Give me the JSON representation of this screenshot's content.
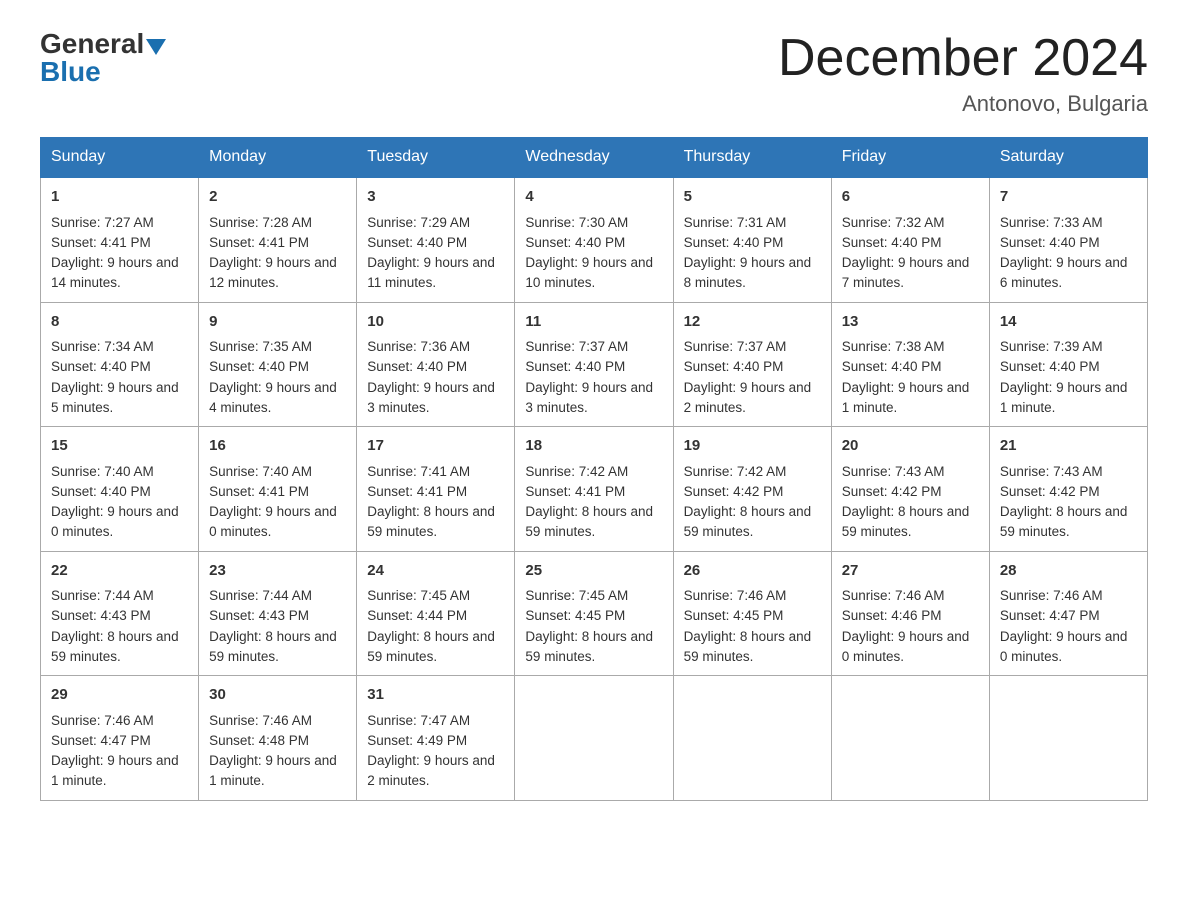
{
  "header": {
    "logo_general": "General",
    "logo_blue": "Blue",
    "month_title": "December 2024",
    "location": "Antonovo, Bulgaria"
  },
  "weekdays": [
    "Sunday",
    "Monday",
    "Tuesday",
    "Wednesday",
    "Thursday",
    "Friday",
    "Saturday"
  ],
  "weeks": [
    [
      {
        "day": "1",
        "sunrise": "7:27 AM",
        "sunset": "4:41 PM",
        "daylight": "9 hours and 14 minutes."
      },
      {
        "day": "2",
        "sunrise": "7:28 AM",
        "sunset": "4:41 PM",
        "daylight": "9 hours and 12 minutes."
      },
      {
        "day": "3",
        "sunrise": "7:29 AM",
        "sunset": "4:40 PM",
        "daylight": "9 hours and 11 minutes."
      },
      {
        "day": "4",
        "sunrise": "7:30 AM",
        "sunset": "4:40 PM",
        "daylight": "9 hours and 10 minutes."
      },
      {
        "day": "5",
        "sunrise": "7:31 AM",
        "sunset": "4:40 PM",
        "daylight": "9 hours and 8 minutes."
      },
      {
        "day": "6",
        "sunrise": "7:32 AM",
        "sunset": "4:40 PM",
        "daylight": "9 hours and 7 minutes."
      },
      {
        "day": "7",
        "sunrise": "7:33 AM",
        "sunset": "4:40 PM",
        "daylight": "9 hours and 6 minutes."
      }
    ],
    [
      {
        "day": "8",
        "sunrise": "7:34 AM",
        "sunset": "4:40 PM",
        "daylight": "9 hours and 5 minutes."
      },
      {
        "day": "9",
        "sunrise": "7:35 AM",
        "sunset": "4:40 PM",
        "daylight": "9 hours and 4 minutes."
      },
      {
        "day": "10",
        "sunrise": "7:36 AM",
        "sunset": "4:40 PM",
        "daylight": "9 hours and 3 minutes."
      },
      {
        "day": "11",
        "sunrise": "7:37 AM",
        "sunset": "4:40 PM",
        "daylight": "9 hours and 3 minutes."
      },
      {
        "day": "12",
        "sunrise": "7:37 AM",
        "sunset": "4:40 PM",
        "daylight": "9 hours and 2 minutes."
      },
      {
        "day": "13",
        "sunrise": "7:38 AM",
        "sunset": "4:40 PM",
        "daylight": "9 hours and 1 minute."
      },
      {
        "day": "14",
        "sunrise": "7:39 AM",
        "sunset": "4:40 PM",
        "daylight": "9 hours and 1 minute."
      }
    ],
    [
      {
        "day": "15",
        "sunrise": "7:40 AM",
        "sunset": "4:40 PM",
        "daylight": "9 hours and 0 minutes."
      },
      {
        "day": "16",
        "sunrise": "7:40 AM",
        "sunset": "4:41 PM",
        "daylight": "9 hours and 0 minutes."
      },
      {
        "day": "17",
        "sunrise": "7:41 AM",
        "sunset": "4:41 PM",
        "daylight": "8 hours and 59 minutes."
      },
      {
        "day": "18",
        "sunrise": "7:42 AM",
        "sunset": "4:41 PM",
        "daylight": "8 hours and 59 minutes."
      },
      {
        "day": "19",
        "sunrise": "7:42 AM",
        "sunset": "4:42 PM",
        "daylight": "8 hours and 59 minutes."
      },
      {
        "day": "20",
        "sunrise": "7:43 AM",
        "sunset": "4:42 PM",
        "daylight": "8 hours and 59 minutes."
      },
      {
        "day": "21",
        "sunrise": "7:43 AM",
        "sunset": "4:42 PM",
        "daylight": "8 hours and 59 minutes."
      }
    ],
    [
      {
        "day": "22",
        "sunrise": "7:44 AM",
        "sunset": "4:43 PM",
        "daylight": "8 hours and 59 minutes."
      },
      {
        "day": "23",
        "sunrise": "7:44 AM",
        "sunset": "4:43 PM",
        "daylight": "8 hours and 59 minutes."
      },
      {
        "day": "24",
        "sunrise": "7:45 AM",
        "sunset": "4:44 PM",
        "daylight": "8 hours and 59 minutes."
      },
      {
        "day": "25",
        "sunrise": "7:45 AM",
        "sunset": "4:45 PM",
        "daylight": "8 hours and 59 minutes."
      },
      {
        "day": "26",
        "sunrise": "7:46 AM",
        "sunset": "4:45 PM",
        "daylight": "8 hours and 59 minutes."
      },
      {
        "day": "27",
        "sunrise": "7:46 AM",
        "sunset": "4:46 PM",
        "daylight": "9 hours and 0 minutes."
      },
      {
        "day": "28",
        "sunrise": "7:46 AM",
        "sunset": "4:47 PM",
        "daylight": "9 hours and 0 minutes."
      }
    ],
    [
      {
        "day": "29",
        "sunrise": "7:46 AM",
        "sunset": "4:47 PM",
        "daylight": "9 hours and 1 minute."
      },
      {
        "day": "30",
        "sunrise": "7:46 AM",
        "sunset": "4:48 PM",
        "daylight": "9 hours and 1 minute."
      },
      {
        "day": "31",
        "sunrise": "7:47 AM",
        "sunset": "4:49 PM",
        "daylight": "9 hours and 2 minutes."
      },
      null,
      null,
      null,
      null
    ]
  ],
  "labels": {
    "sunrise_prefix": "Sunrise: ",
    "sunset_prefix": "Sunset: ",
    "daylight_prefix": "Daylight: "
  }
}
